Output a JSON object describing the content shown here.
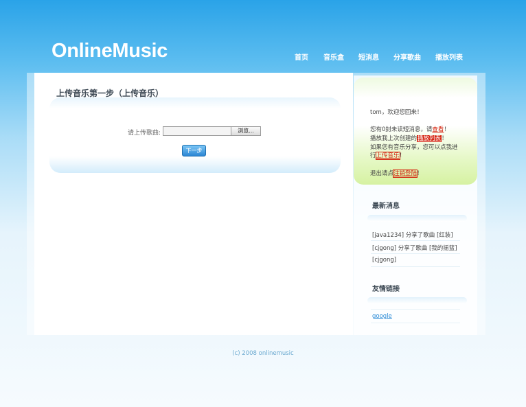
{
  "header": {
    "logo": "OnlineMusic",
    "nav": [
      "首页",
      "音乐盒",
      "短消息",
      "分享歌曲",
      "播放列表"
    ]
  },
  "main": {
    "title": "上传音乐第一步（上传音乐）",
    "upload_label": "请上传歌曲:",
    "file_value": "",
    "browse_label": "浏览...",
    "next_label": "下一步"
  },
  "sidebar": {
    "welcome": "tom，欢迎您回来！",
    "line1_pre": "您有0封未读短消息，请",
    "line1_link": "查看",
    "line1_post": "！",
    "line2_pre": "播放我上次创建的",
    "line2_link": "播放列表",
    "line2_post": "！",
    "line3_a": "如果您有音乐分享，您可以点我进",
    "line3_b_pre": "行",
    "line3_b_link": "上传音乐",
    "line3_b_post": "！",
    "logout_pre": "退出请点",
    "logout_link": "注销登陆",
    "logout_post": "！",
    "news_title": "最新消息",
    "news": [
      "[java1234] 分享了歌曲 [红装]",
      "[cjgong] 分享了歌曲 [我的摇篮]",
      "[cjgong]"
    ],
    "links_title": "友情链接",
    "links": [
      "google"
    ]
  },
  "footer": {
    "text": "(c) 2008 onlinemusic"
  },
  "colors": {
    "accent": "#2aa3e8",
    "link_red": "#d4200c",
    "link_blue": "#2a8ad6"
  }
}
